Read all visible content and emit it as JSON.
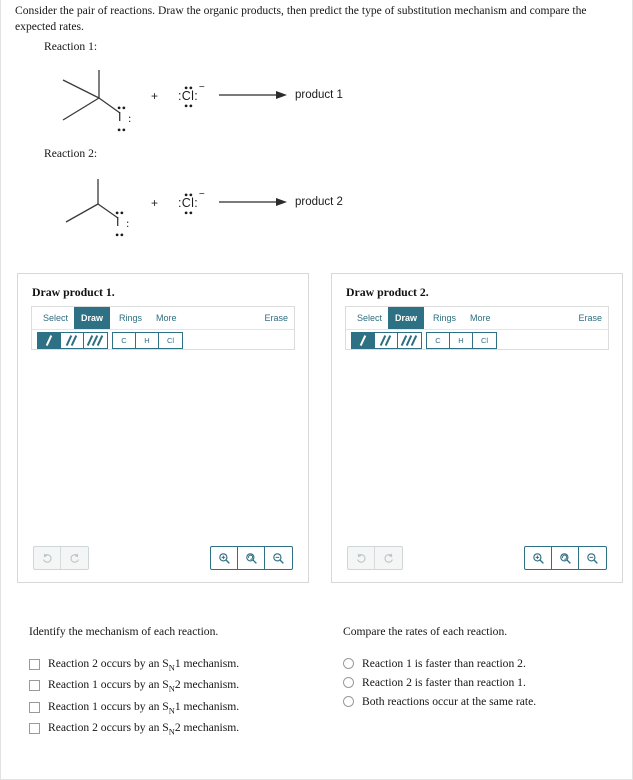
{
  "prompt": "Consider the pair of reactions. Draw the organic products, then predict the type of substitution mechanism and compare the expected rates.",
  "reactions": [
    {
      "label": "Reaction 1:",
      "substrate_name": "tert-butyl iodide",
      "substrate_halogen": "I",
      "plus": "+",
      "reagent": "Cl",
      "reagent_charge": "−",
      "product": "product 1"
    },
    {
      "label": "Reaction 2:",
      "substrate_name": "isopropyl iodide",
      "substrate_halogen": "I",
      "plus": "+",
      "reagent": "Cl",
      "reagent_charge": "−",
      "product": "product 2"
    }
  ],
  "panels": [
    {
      "title": "Draw product 1.",
      "tabs": [
        "Select",
        "Draw",
        "Rings",
        "More"
      ],
      "active_tab": "Draw",
      "erase_label": "Erase",
      "bond_tools": [
        "single-bond",
        "double-bond",
        "triple-bond"
      ],
      "selected_bond_tool": "single-bond",
      "element_tools": [
        "C",
        "H",
        "Cl"
      ],
      "undo_icons": [
        "undo-icon",
        "redo-icon"
      ],
      "zoom_icons": [
        "zoom-in-icon",
        "zoom-reset-icon",
        "zoom-out-icon"
      ]
    },
    {
      "title": "Draw product 2.",
      "tabs": [
        "Select",
        "Draw",
        "Rings",
        "More"
      ],
      "active_tab": "Draw",
      "erase_label": "Erase",
      "bond_tools": [
        "single-bond",
        "double-bond",
        "triple-bond"
      ],
      "selected_bond_tool": "single-bond",
      "element_tools": [
        "C",
        "H",
        "Cl"
      ],
      "undo_icons": [
        "undo-icon",
        "redo-icon"
      ],
      "zoom_icons": [
        "zoom-in-icon",
        "zoom-reset-icon",
        "zoom-out-icon"
      ]
    }
  ],
  "mechanism_question": {
    "title": "Identify the mechanism of each reaction.",
    "input_type": "checkbox",
    "options": [
      {
        "prefix": "Reaction 2 occurs by an S",
        "sub": "N",
        "suffix": "1 mechanism."
      },
      {
        "prefix": "Reaction 1 occurs by an S",
        "sub": "N",
        "suffix": "2 mechanism."
      },
      {
        "prefix": "Reaction 1 occurs by an S",
        "sub": "N",
        "suffix": "1 mechanism."
      },
      {
        "prefix": "Reaction 2 occurs by an S",
        "sub": "N",
        "suffix": "2 mechanism."
      }
    ]
  },
  "rates_question": {
    "title": "Compare the rates of each reaction.",
    "input_type": "radio",
    "options": [
      {
        "label": "Reaction 1 is faster than reaction 2."
      },
      {
        "label": "Reaction 2 is faster than reaction 1."
      },
      {
        "label": "Both reactions occur at the same rate."
      }
    ]
  },
  "colors": {
    "accent": "#2e7184",
    "accent_text": "#2e6f80",
    "text": "#161616",
    "panel_border": "#d8d8d8"
  }
}
